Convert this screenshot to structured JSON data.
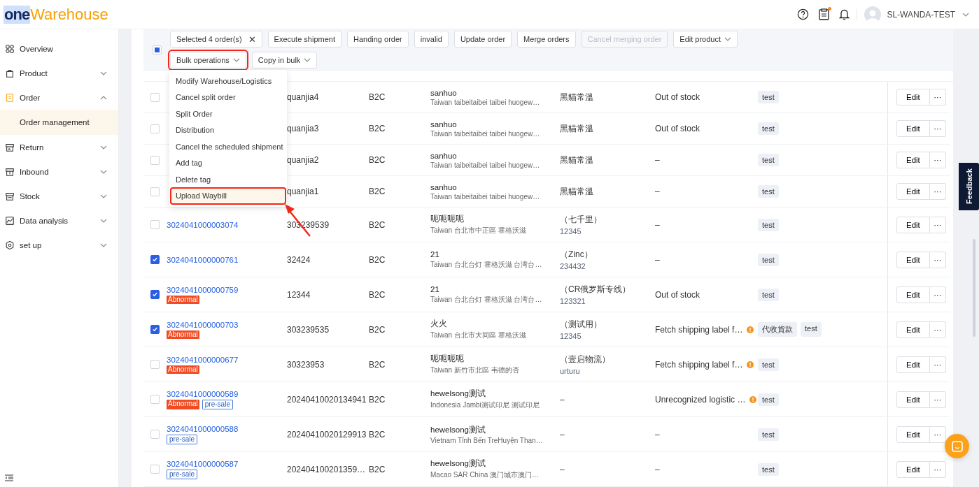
{
  "header": {
    "logo": {
      "part_1": "one",
      "part_2": "Warehouse"
    },
    "notification_dot": true,
    "user": "SL-WANDA-TEST"
  },
  "sidebar": {
    "items": [
      {
        "label": "Overview",
        "has_children": false,
        "expanded": false
      },
      {
        "label": "Product",
        "has_children": true,
        "expanded": false
      },
      {
        "label": "Order",
        "has_children": true,
        "expanded": true,
        "children": [
          {
            "label": "Order management",
            "selected": true
          }
        ]
      },
      {
        "label": "Return",
        "has_children": true,
        "expanded": false
      },
      {
        "label": "Inbound",
        "has_children": true,
        "expanded": false
      },
      {
        "label": "Stock",
        "has_children": true,
        "expanded": false
      },
      {
        "label": "Data analysis",
        "has_children": true,
        "expanded": false
      },
      {
        "label": "set up",
        "has_children": true,
        "expanded": false
      }
    ]
  },
  "toolbar": {
    "select_all": {
      "checked": false,
      "partial": true
    },
    "selection": "Selected 4 order(s)",
    "clear": "✕",
    "buttons": [
      {
        "label": "Execute shipment",
        "disabled": false,
        "dropdown": false,
        "annotated": false
      },
      {
        "label": "Handing order",
        "disabled": false,
        "dropdown": false,
        "annotated": false
      },
      {
        "label": "invalid",
        "disabled": false,
        "dropdown": false,
        "annotated": false
      },
      {
        "label": "Update order",
        "disabled": false,
        "dropdown": false,
        "annotated": false
      },
      {
        "label": "Merge orders",
        "disabled": false,
        "dropdown": false,
        "annotated": false
      },
      {
        "label": "Cancel merging order",
        "disabled": true,
        "dropdown": false,
        "annotated": false
      },
      {
        "label": "Edit product",
        "disabled": false,
        "dropdown": true,
        "annotated": false
      },
      {
        "label": "Bulk operations",
        "disabled": false,
        "dropdown": true,
        "annotated": true
      },
      {
        "label": "Copy in bulk",
        "disabled": false,
        "dropdown": true,
        "annotated": false
      }
    ]
  },
  "bulk_menu": {
    "items": [
      {
        "label": "Modify Warehouse/Logistics",
        "selected": false,
        "annotated": false
      },
      {
        "label": "Cancel split order",
        "selected": false,
        "annotated": false
      },
      {
        "label": "Split Order",
        "selected": false,
        "annotated": false
      },
      {
        "label": "Distribution",
        "selected": false,
        "annotated": false
      },
      {
        "label": "Cancel the scheduled shipment",
        "selected": false,
        "annotated": false
      },
      {
        "label": "Add tag",
        "selected": false,
        "annotated": false
      },
      {
        "label": "Delete tag",
        "selected": false,
        "annotated": false
      },
      {
        "label": "Upload Waybill",
        "selected": true,
        "annotated": true
      }
    ]
  },
  "table": {
    "rows": [
      {
        "checked": false,
        "ref": "quanjia4",
        "type": "B2C",
        "recipient": "sanhuo",
        "address": "Taiwan taibeitaibei taibei huogew…",
        "logistics": "黑貓常溫",
        "status": "Out of stock",
        "warning": false,
        "tags": [
          "test"
        ],
        "edit": "Edit",
        "more": "···"
      },
      {
        "checked": false,
        "ref": "quanjia3",
        "type": "B2C",
        "recipient": "sanhuo",
        "address": "Taiwan taibeitaibei taibei huogew…",
        "logistics": "黑貓常溫",
        "status": "Out of stock",
        "warning": false,
        "tags": [
          "test"
        ],
        "edit": "Edit",
        "more": "···"
      },
      {
        "checked": false,
        "ref": "quanjia2",
        "type": "B2C",
        "recipient": "sanhuo",
        "address": "Taiwan taibeitaibei taibei huogew…",
        "logistics": "黑貓常溫",
        "status": "–",
        "warning": false,
        "tags": [
          "test"
        ],
        "edit": "Edit",
        "more": "···"
      },
      {
        "checked": false,
        "ref": "quanjia1",
        "type": "B2C",
        "recipient": "sanhuo",
        "address": "Taiwan taibeitaibei taibei huogew…",
        "logistics": "黑貓常溫",
        "status": "–",
        "warning": false,
        "tags": [
          "test"
        ],
        "edit": "Edit",
        "more": "···"
      },
      {
        "checked": false,
        "order_no": "3024041000003074",
        "labels": [],
        "ref": "303239539",
        "type": "B2C",
        "recipient": "呃呃呃呃",
        "address": "Taiwan 台北市中正區 霍格沃滋",
        "logistics": "（七千里）",
        "tracking": "12345",
        "status": "–",
        "warning": false,
        "tags": [
          "test"
        ],
        "edit": "Edit",
        "more": "···"
      },
      {
        "checked": true,
        "order_no": "3024041000000761",
        "labels": [],
        "ref": "32424",
        "type": "B2C",
        "recipient": "21",
        "address": "Taiwan 台北台灯 霍格沃滋 台湾台…",
        "logistics": "（Zinc）",
        "tracking": "234432",
        "status": "–",
        "warning": false,
        "tags": [
          "test"
        ],
        "edit": "Edit",
        "more": "···"
      },
      {
        "checked": true,
        "order_no": "3024041000000759",
        "labels": [
          {
            "text": "Abnormal",
            "kind": "abnormal"
          }
        ],
        "ref": "12344",
        "type": "B2C",
        "recipient": "21",
        "address": "Taiwan 台北台灯 霍格沃滋 台湾台…",
        "logistics": "（CR俄罗斯专线）",
        "tracking": "123321",
        "status": "Out of stock",
        "warning": false,
        "tags": [
          "test"
        ],
        "edit": "Edit",
        "more": "···"
      },
      {
        "checked": true,
        "order_no": "3024041000000703",
        "labels": [
          {
            "text": "Abnormal",
            "kind": "abnormal"
          }
        ],
        "ref": "303239535",
        "type": "B2C",
        "recipient": "火火",
        "address": "Taiwan 台北市大同區 霍格沃滋",
        "logistics": "（测试用）",
        "tracking": "12345",
        "status": "Fetch shipping label f…",
        "warning": true,
        "tags": [
          "代收貨款",
          "test"
        ],
        "edit": "Edit",
        "more": "···"
      },
      {
        "checked": false,
        "order_no": "3024041000000677",
        "labels": [
          {
            "text": "Abnormal",
            "kind": "abnormal"
          }
        ],
        "ref": "30323953",
        "type": "B2C",
        "recipient": "呃呃呃呃",
        "address": "Taiwan 新竹市北區 韦德的否",
        "logistics": "（壹启物流）",
        "tracking": "urturu",
        "status": "Fetch shipping label f…",
        "warning": true,
        "tags": [
          "test"
        ],
        "edit": "Edit",
        "more": "···"
      },
      {
        "checked": false,
        "order_no": "3024041000000589",
        "labels": [
          {
            "text": "Abnormal",
            "kind": "abnormal"
          },
          {
            "text": "pre-sale",
            "kind": "presale"
          }
        ],
        "ref": "20240410020134941",
        "type": "B2C",
        "recipient": "hewelsong测试",
        "address": "Indonesia Jambi测试印尼 测试印尼",
        "logistics": "–",
        "status": "Unrecognized logistic …",
        "warning": true,
        "tags": [
          "test"
        ],
        "edit": "Edit",
        "more": "···"
      },
      {
        "checked": false,
        "order_no": "3024041000000588",
        "labels": [
          {
            "text": "pre-sale",
            "kind": "presale"
          }
        ],
        "ref": "20240410020129913",
        "type": "B2C",
        "recipient": "hewelsong测试",
        "address": "Vietnam Tỉnh Bến TreHuyện Thạn…",
        "logistics": "–",
        "status": "–",
        "warning": false,
        "tags": [
          "test"
        ],
        "edit": "Edit",
        "more": "···"
      },
      {
        "checked": false,
        "order_no": "3024041000000587",
        "labels": [
          {
            "text": "pre-sale",
            "kind": "presale"
          }
        ],
        "ref": "202404100201359…",
        "type": "B2C",
        "recipient": "hewelsong测试",
        "address": "Macao SAR China 澳门城市澳门…",
        "logistics": "–",
        "status": "–",
        "warning": false,
        "tags": [
          "test"
        ],
        "edit": "Edit",
        "more": "···"
      }
    ]
  },
  "feedback": "Feedback"
}
